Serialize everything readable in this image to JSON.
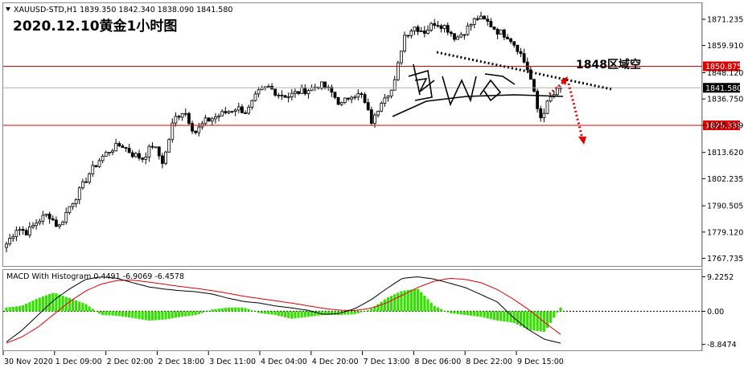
{
  "header": {
    "symbol_info": "XAUUSD-STD,H1  1839.350 1842.340 1838.090 1841.580",
    "title": "2020.12.10黄金1小时图",
    "annotation": "1848区域空"
  },
  "macd_label": "MACD With Histogram 0.4491 -6.9069 -6.4578",
  "price_axis": {
    "ticks": [
      "1871.235",
      "1859.910",
      "1848.120",
      "1836.750",
      "1825.339",
      "1813.620",
      "1802.235",
      "1790.505",
      "1779.120",
      "1767.735"
    ],
    "tick_values": [
      1871.235,
      1859.91,
      1848.12,
      1836.75,
      1825.339,
      1813.62,
      1802.235,
      1790.505,
      1779.12,
      1767.735
    ],
    "current_price": "1841.580",
    "resistance_tag": "1850.875",
    "support_tag": "1825.339"
  },
  "macd_axis": {
    "ticks": [
      "9.2252",
      "0.00",
      "-8.8474"
    ],
    "tick_values": [
      9.2252,
      0,
      -8.8474
    ]
  },
  "time_axis": {
    "labels": [
      "30 Nov 2020",
      "1 Dec 09:00",
      "2 Dec 02:00",
      "2 Dec 18:00",
      "3 Dec 11:00",
      "4 Dec 04:00",
      "4 Dec 20:00",
      "7 Dec 13:00",
      "8 Dec 06:00",
      "8 Dec 22:00",
      "9 Dec 15:00"
    ]
  },
  "colors": {
    "up": "#000000",
    "down": "#000000",
    "up_fill": "#ffffff",
    "down_fill": "#000000",
    "hline": "#e00000",
    "histogram": "#33e000",
    "signal": "#e00000",
    "macd": "#000000",
    "tag_bg": "#e00000",
    "tag_current": "#000000",
    "arrow": "#e00000"
  },
  "chart_data": {
    "type": "candlestick",
    "title": "2020.12.10黄金1小时图",
    "symbol": "XAUUSD-STD",
    "timeframe": "H1",
    "ylim": [
      1765.5,
      1877.5
    ],
    "horizontal_lines": [
      1850.875,
      1825.339
    ],
    "annotations": [
      "1848区域空"
    ],
    "series": [
      {
        "name": "price_path",
        "values": [
          1774,
          1781,
          1779,
          1784,
          1787,
          1781,
          1790,
          1797,
          1805,
          1811,
          1815,
          1817,
          1813,
          1811,
          1817,
          1809,
          1828,
          1832,
          1822,
          1827,
          1829,
          1831,
          1833,
          1831,
          1839,
          1842,
          1839,
          1838,
          1840,
          1841,
          1843,
          1840,
          1834,
          1839,
          1838,
          1826,
          1838,
          1841,
          1864,
          1868,
          1866,
          1870,
          1868,
          1863,
          1867,
          1872,
          1870,
          1866,
          1864,
          1858,
          1848,
          1828,
          1837,
          1841.58
        ]
      },
      {
        "name": "MACD",
        "values": [
          -8.2,
          -5,
          -1,
          3,
          6,
          8.5,
          9.2,
          8.8,
          7.6,
          6.5,
          5.9,
          5.5,
          5.2,
          4.6,
          3.5,
          2.6,
          2.2,
          1.4,
          0.9,
          0.3,
          -0.8,
          -0.6,
          0.7,
          3,
          6,
          8.8,
          9.2,
          8.6,
          7.5,
          6.3,
          4.4,
          2.5,
          -1.6,
          -5,
          -7.5,
          -8.5
        ]
      },
      {
        "name": "Signal",
        "values": [
          -8.5,
          -6.8,
          -4.2,
          -0.8,
          2.6,
          5.4,
          7.3,
          8.2,
          8.3,
          7.8,
          7.2,
          6.6,
          6.1,
          5.5,
          4.8,
          4,
          3.4,
          2.8,
          2.2,
          1.5,
          0.8,
          0.3,
          0.2,
          0.8,
          2.2,
          4.3,
          6.4,
          8,
          8.8,
          8.5,
          7.6,
          5.8,
          3.3,
          0.4,
          -3,
          -6.2
        ]
      },
      {
        "name": "Histogram",
        "values": [
          1,
          1.5,
          3.5,
          5,
          3.5,
          2,
          -1,
          -1.2,
          -1.8,
          -2.5,
          -2.2,
          -1.5,
          -1,
          0.5,
          1,
          1,
          -0.5,
          -1,
          -2,
          -1.5,
          -1,
          -1,
          -0.8,
          0.5,
          3.5,
          5.5,
          6,
          1.5,
          -0.5,
          -1,
          -1.5,
          -2.5,
          -3,
          -5,
          -5.5,
          1
        ]
      }
    ]
  }
}
